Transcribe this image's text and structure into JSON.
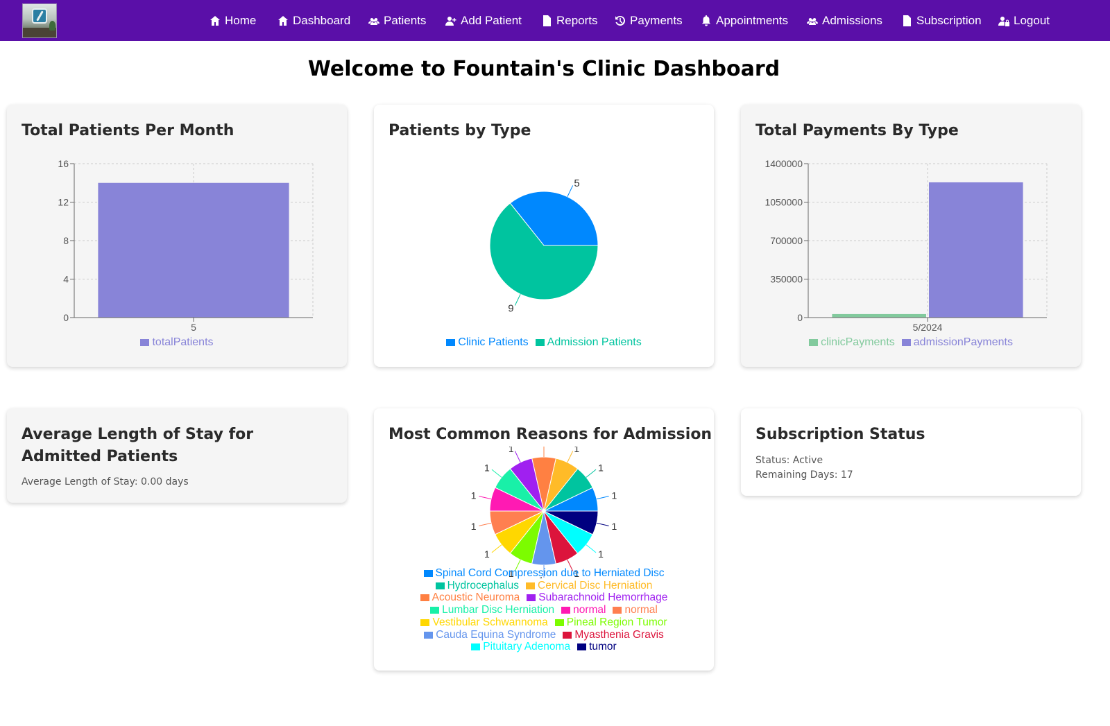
{
  "nav": {
    "items": [
      {
        "label": "Home",
        "icon": "home-icon"
      },
      {
        "label": "Dashboard",
        "icon": "home-icon"
      },
      {
        "label": "Patients",
        "icon": "users-icon"
      },
      {
        "label": "Add Patient",
        "icon": "user-plus-icon"
      },
      {
        "label": "Reports",
        "icon": "file-icon"
      },
      {
        "label": "Payments",
        "icon": "history-icon"
      },
      {
        "label": "Appointments",
        "icon": "bell-icon"
      },
      {
        "label": "Admissions",
        "icon": "users-icon"
      },
      {
        "label": "Subscription",
        "icon": "file-icon"
      },
      {
        "label": "Logout",
        "icon": "user-lock-icon"
      }
    ],
    "color": "#5a0fa8"
  },
  "page_title": "Welcome to Fountain's Clinic Dashboard",
  "cards": {
    "patients_per_month": {
      "title": "Total Patients Per Month"
    },
    "patients_by_type": {
      "title": "Patients by Type"
    },
    "payments_by_type": {
      "title": "Total Payments By Type"
    },
    "avg_stay": {
      "title": "Average Length of Stay for Admitted Patients",
      "text": "Average Length of Stay: 0.00 days"
    },
    "admission_reasons": {
      "title": "Most Common Reasons for Admission"
    },
    "subscription": {
      "title": "Subscription Status",
      "status": "Status: Active",
      "remaining": "Remaining Days: 17"
    }
  },
  "chart_data": [
    {
      "type": "bar",
      "title": "Total Patients Per Month",
      "categories": [
        "5"
      ],
      "series": [
        {
          "name": "totalPatients",
          "values": [
            14
          ],
          "color": "#8884d8"
        }
      ],
      "ylim": [
        0,
        16
      ],
      "yticks": [
        "0",
        "4",
        "8",
        "12",
        "16"
      ],
      "grid": true,
      "legend": "bottom"
    },
    {
      "type": "pie",
      "title": "Patients by Type",
      "slices": [
        {
          "name": "Clinic Patients",
          "value": 5,
          "label": "5",
          "color": "#0088fe"
        },
        {
          "name": "Admission Patients",
          "value": 9,
          "label": "9",
          "color": "#00c49f"
        }
      ],
      "legend": "bottom"
    },
    {
      "type": "bar",
      "title": "Total Payments By Type",
      "categories": [
        "5/2024"
      ],
      "series": [
        {
          "name": "clinicPayments",
          "values": [
            32000
          ],
          "color": "#82ca9d"
        },
        {
          "name": "admissionPayments",
          "values": [
            1230000
          ],
          "color": "#8884d8"
        }
      ],
      "ylim": [
        0,
        1400000
      ],
      "yticks": [
        "0",
        "350000",
        "700000",
        "1050000",
        "1400000"
      ],
      "grid": true,
      "legend": "bottom"
    },
    {
      "type": "pie",
      "title": "Most Common Reasons for Admission",
      "slices": [
        {
          "name": "Spinal Cord Compression due to Herniated Disc",
          "value": 1,
          "label": "1",
          "color": "#0088fe"
        },
        {
          "name": "Hydrocephalus",
          "value": 1,
          "label": "1",
          "color": "#00c49f"
        },
        {
          "name": "Cervical Disc Herniation",
          "value": 1,
          "label": "1",
          "color": "#ffbb28"
        },
        {
          "name": "Acoustic Neuroma",
          "value": 1,
          "label": "1",
          "color": "#ff8042"
        },
        {
          "name": "Subarachnoid Hemorrhage",
          "value": 1,
          "label": "1",
          "color": "#a020f0"
        },
        {
          "name": "Lumbar Disc Herniation",
          "value": 1,
          "label": "1",
          "color": "#19f0a8"
        },
        {
          "name": "normal",
          "value": 1,
          "label": "1",
          "color": "#ff1ab3"
        },
        {
          "name": "normal",
          "value": 1,
          "label": "1",
          "color": "#ff7f50"
        },
        {
          "name": "Vestibular Schwannoma",
          "value": 1,
          "label": "1",
          "color": "#ffd700"
        },
        {
          "name": "Pineal Region Tumor",
          "value": 1,
          "label": "1",
          "color": "#7cfc00"
        },
        {
          "name": "Cauda Equina Syndrome",
          "value": 1,
          "label": "1",
          "color": "#6495ed"
        },
        {
          "name": "Myasthenia Gravis",
          "value": 1,
          "label": "1",
          "color": "#dc143c"
        },
        {
          "name": "Pituitary Adenoma",
          "value": 1,
          "label": "1",
          "color": "#00ffff"
        },
        {
          "name": "tumor",
          "value": 1,
          "label": "1",
          "color": "#000080"
        }
      ],
      "legend": "bottom"
    }
  ]
}
